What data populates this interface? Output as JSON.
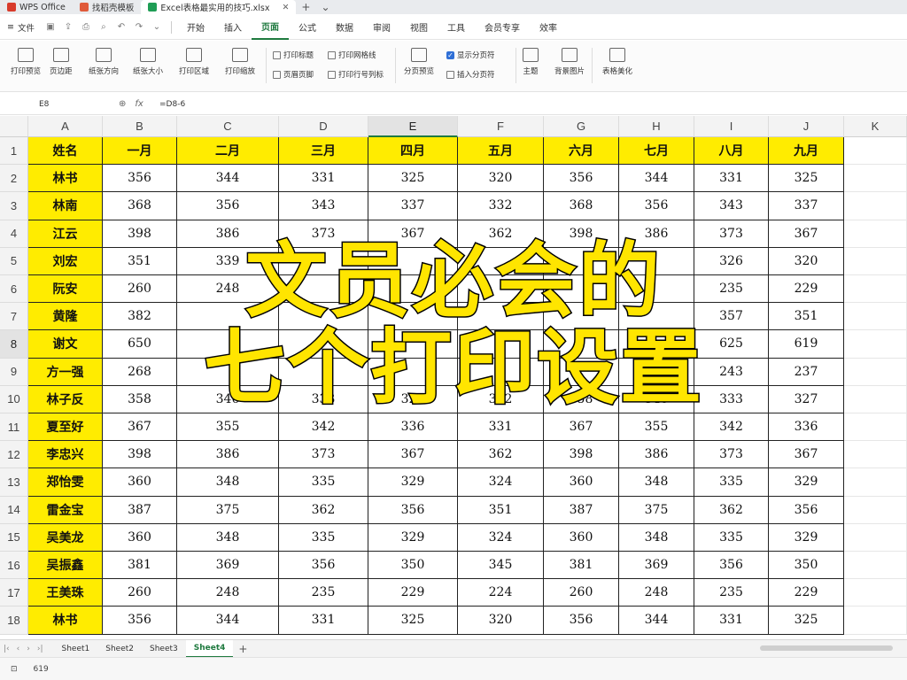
{
  "tabs": [
    {
      "label": "WPS Office",
      "color": "#d83b2b"
    },
    {
      "label": "找稻壳模板",
      "color": "#e05a3a"
    },
    {
      "label": "Excel表格最实用的技巧.xlsx",
      "color": "#1f9d55"
    }
  ],
  "file_menu": "文件",
  "menu": [
    "开始",
    "插入",
    "页面",
    "公式",
    "数据",
    "审阅",
    "视图",
    "工具",
    "会员专享",
    "效率"
  ],
  "menu_active": "页面",
  "ribbon": {
    "print_preview": "打印预览",
    "margins": "页边距",
    "orientation": "纸张方向",
    "paper_size": "纸张大小",
    "print_area": "打印区域",
    "print_scale": "打印缩放",
    "print_titles": "打印标题",
    "header_footer": "页眉页脚",
    "print_gridlines": "打印网格线",
    "print_row_col_headers": "打印行号列标",
    "page_break_preview": "分页预览",
    "show_page_breaks": "显示分页符",
    "insert_page_break": "插入分页符",
    "theme": "主题",
    "background_image": "背景图片",
    "table_beautify": "表格美化"
  },
  "formula_bar": {
    "cell": "E8",
    "fx": "fx",
    "formula": "=D8-6"
  },
  "columns": [
    "A",
    "B",
    "C",
    "D",
    "E",
    "F",
    "G",
    "H",
    "I",
    "J",
    "K"
  ],
  "selected_column": "E",
  "selected_row": "8",
  "header_row": [
    "姓名",
    "一月",
    "二月",
    "三月",
    "四月",
    "五月",
    "六月",
    "七月",
    "八月",
    "九月"
  ],
  "rows": [
    [
      "林书",
      "356",
      "344",
      "331",
      "325",
      "320",
      "356",
      "344",
      "331",
      "325"
    ],
    [
      "林南",
      "368",
      "356",
      "343",
      "337",
      "332",
      "368",
      "356",
      "343",
      "337"
    ],
    [
      "江云",
      "398",
      "386",
      "373",
      "367",
      "362",
      "398",
      "386",
      "373",
      "367"
    ],
    [
      "刘宏",
      "351",
      "339",
      "",
      "",
      "",
      "",
      "",
      "326",
      "320"
    ],
    [
      "阮安",
      "260",
      "248",
      "",
      "",
      "",
      "",
      "",
      "235",
      "229"
    ],
    [
      "黄隆",
      "382",
      "",
      "",
      "",
      "",
      "",
      "",
      "357",
      "351"
    ],
    [
      "谢文",
      "650",
      "",
      "",
      "",
      "",
      "",
      "",
      "625",
      "619"
    ],
    [
      "方一强",
      "268",
      "",
      "",
      "",
      "",
      "",
      "",
      "243",
      "237"
    ],
    [
      "林子反",
      "358",
      "346",
      "333",
      "327",
      "322",
      "358",
      "346",
      "333",
      "327"
    ],
    [
      "夏至好",
      "367",
      "355",
      "342",
      "336",
      "331",
      "367",
      "355",
      "342",
      "336"
    ],
    [
      "李忠兴",
      "398",
      "386",
      "373",
      "367",
      "362",
      "398",
      "386",
      "373",
      "367"
    ],
    [
      "郑怡雯",
      "360",
      "348",
      "335",
      "329",
      "324",
      "360",
      "348",
      "335",
      "329"
    ],
    [
      "雷金宝",
      "387",
      "375",
      "362",
      "356",
      "351",
      "387",
      "375",
      "362",
      "356"
    ],
    [
      "吴美龙",
      "360",
      "348",
      "335",
      "329",
      "324",
      "360",
      "348",
      "335",
      "329"
    ],
    [
      "吴振鑫",
      "381",
      "369",
      "356",
      "350",
      "345",
      "381",
      "369",
      "356",
      "350"
    ],
    [
      "王美珠",
      "260",
      "248",
      "235",
      "229",
      "224",
      "260",
      "248",
      "235",
      "229"
    ],
    [
      "林书",
      "356",
      "344",
      "331",
      "325",
      "320",
      "356",
      "344",
      "331",
      "325"
    ]
  ],
  "overlay": {
    "line1": "文员必会的",
    "line2": "七个打印设置"
  },
  "sheets": [
    "Sheet1",
    "Sheet2",
    "Sheet3",
    "Sheet4"
  ],
  "active_sheet": "Sheet4",
  "status_value": "619",
  "colors": {
    "header_fill": "#ffec00",
    "accent": "#1f7a3f",
    "overlay_text": "#ffe500"
  }
}
